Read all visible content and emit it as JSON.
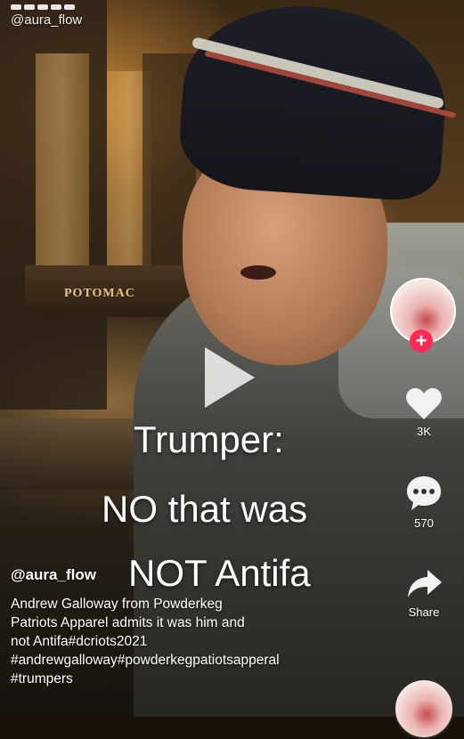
{
  "watermark": {
    "handle": "@aura_flow"
  },
  "caption": {
    "line1": "Trumper:",
    "line2": "NO that was",
    "line3": "NOT Antifa"
  },
  "author": {
    "handle": "@aura_flow"
  },
  "description": {
    "lines": [
      "Andrew Galloway from Powderkeg",
      "Patriots Apparel admits it was him and",
      "not Antifa#dcriots2021",
      "#andrewgalloway#powderkegpatiotsapperal",
      "#trumpers"
    ]
  },
  "actions": {
    "likes": "3K",
    "comments": "570",
    "share_label": "Share"
  },
  "background_sign": "POTOMAC",
  "colors": {
    "follow_badge": "#fe2c55",
    "text": "#ffffff"
  },
  "icons": [
    "play-icon",
    "heart-icon",
    "comment-icon",
    "share-icon",
    "plus-icon",
    "music-disc-icon"
  ]
}
